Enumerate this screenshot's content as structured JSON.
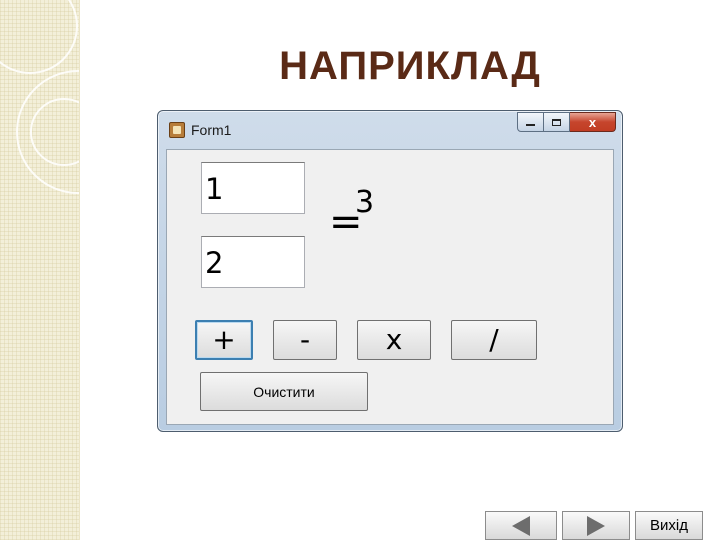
{
  "slide": {
    "title": "НАПРИКЛАД"
  },
  "window": {
    "title": "Form1",
    "close_glyph": "x",
    "icons": {
      "app": "app-icon",
      "minimize": "minimize-icon",
      "maximize": "maximize-icon",
      "close": "close-icon"
    }
  },
  "form": {
    "operand1": "1",
    "operand2": "2",
    "equals_sign": "=",
    "result": "3",
    "buttons": {
      "add": "+",
      "subtract": "-",
      "multiply": "x",
      "divide": "/",
      "clear": "Очистити"
    }
  },
  "navigation": {
    "exit_label": "Вихід",
    "prev_icon": "triangle-left-icon",
    "next_icon": "triangle-right-icon"
  },
  "colors": {
    "title": "#5a2a16",
    "close_button": "#c6452d",
    "focus_border": "#3c7fb1"
  }
}
